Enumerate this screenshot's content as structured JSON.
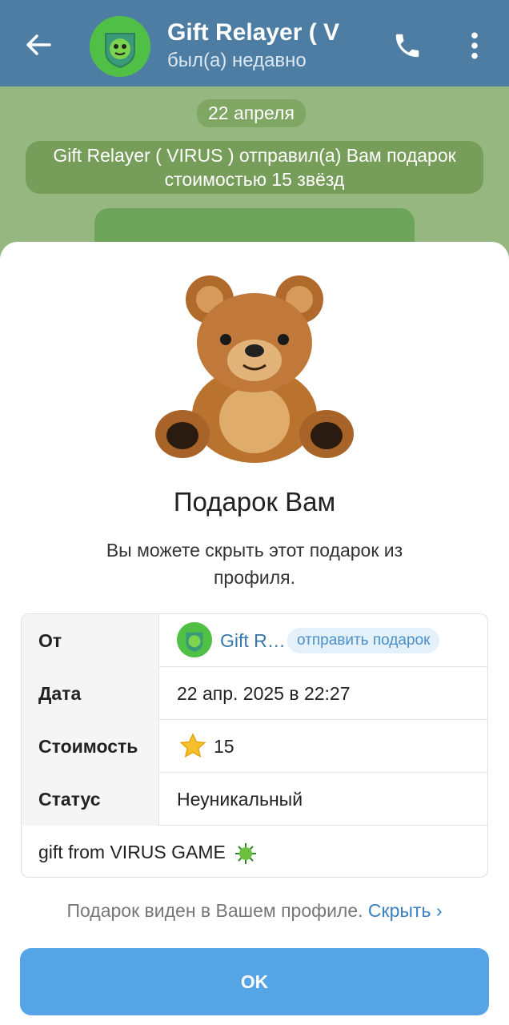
{
  "header": {
    "title": "Gift Relayer ( V",
    "status": "был(а) недавно"
  },
  "chat": {
    "date": "22 апреля",
    "service_message_line1": "Gift Relayer ( VIRUS ) отправил(а) Вам подарок",
    "service_message_line2": "стоимостью 15 звёзд"
  },
  "sheet": {
    "title": "Подарок Вам",
    "description": "Вы можете скрыть этот подарок из профиля.",
    "rows": {
      "from_label": "От",
      "from_name": "Gift R…",
      "send_gift": "отправить подарок",
      "date_label": "Дата",
      "date_value": "22 апр. 2025 в 22:27",
      "cost_label": "Стоимость",
      "cost_value": "15",
      "status_label": "Статус",
      "status_value": "Неуникальный",
      "note": "gift from VIRUS GAME"
    },
    "footer_text": "Подарок виден в Вашем профиле.",
    "footer_link": "Скрыть",
    "ok_label": "OK"
  },
  "colors": {
    "header_bg": "#4e7da3",
    "accent": "#55a4e6",
    "link": "#3a7fc0"
  },
  "icons": [
    "back-arrow-icon",
    "phone-icon",
    "more-vert-icon",
    "star-icon",
    "virus-icon",
    "chevron-right-icon"
  ]
}
